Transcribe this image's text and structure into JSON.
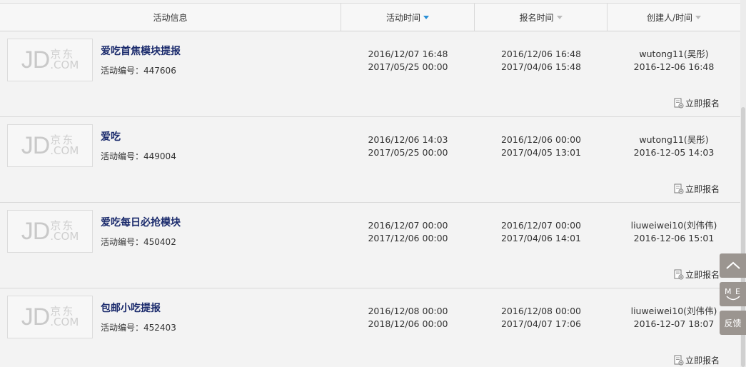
{
  "header": {
    "col_info": "活动信息",
    "col_activity_time": "活动时间",
    "col_signup_time": "报名时间",
    "col_creator": "创建人/时间"
  },
  "logo": {
    "jd": "JD",
    "cn": "京东",
    "com": ".COM"
  },
  "id_label": "活动编号：",
  "signup_label": "立即报名",
  "rows": [
    {
      "title": "爱吃首焦模块提报",
      "id": "447606",
      "activity_start": "2016/12/07 16:48",
      "activity_end": "2017/05/25 00:00",
      "signup_start": "2016/12/06 16:48",
      "signup_end": "2017/04/06 15:48",
      "creator": "wutong11(吴彤)",
      "created": "2016-12-06 16:48"
    },
    {
      "title": "爱吃",
      "id": "449004",
      "activity_start": "2016/12/06 14:03",
      "activity_end": "2017/05/25 00:00",
      "signup_start": "2016/12/06 00:00",
      "signup_end": "2017/04/05 13:01",
      "creator": "wutong11(吴彤)",
      "created": "2016-12-05 14:03"
    },
    {
      "title": "爱吃每日必抢模块",
      "id": "450402",
      "activity_start": "2016/12/07 00:00",
      "activity_end": "2017/12/06 00:00",
      "signup_start": "2016/12/07 00:00",
      "signup_end": "2017/04/06 14:01",
      "creator": "liuweiwei10(刘伟伟)",
      "created": "2016-12-06 15:01"
    },
    {
      "title": "包邮小吃提报",
      "id": "452403",
      "activity_start": "2016/12/08 00:00",
      "activity_end": "2018/12/06 00:00",
      "signup_start": "2016/12/08 00:00",
      "signup_end": "2017/04/07 17:06",
      "creator": "liuweiwei10(刘伟伟)",
      "created": "2016-12-07 18:07"
    }
  ],
  "sidebar": {
    "top_icon": "chevron-up-icon",
    "me_label": "M E",
    "feedback_label": "反馈"
  },
  "colors": {
    "title": "#1a2a6c",
    "sort_active": "#2a8fd6",
    "side_button": "#9b9590"
  }
}
